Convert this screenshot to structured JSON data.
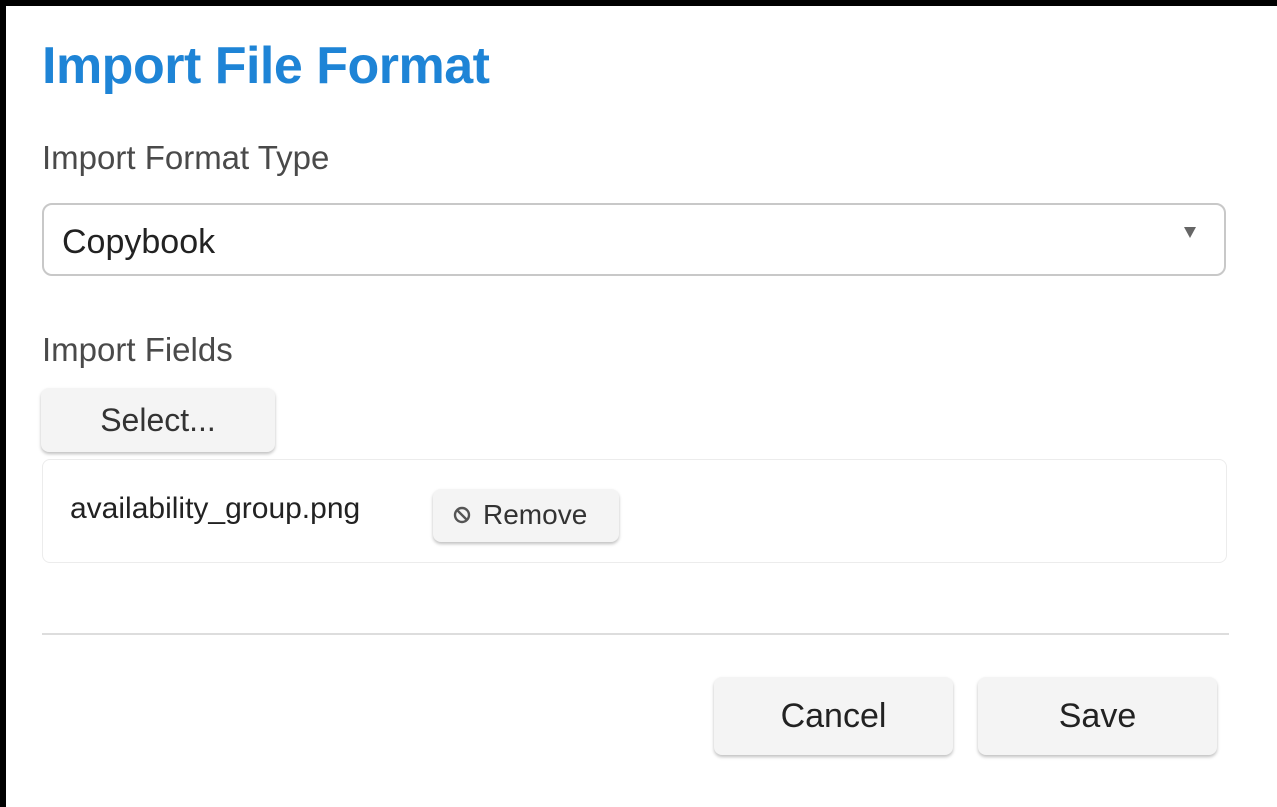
{
  "dialog": {
    "title": "Import File Format",
    "format_type": {
      "label": "Import Format Type",
      "selected_value": "Copybook",
      "arrow_icon": "caret-down-icon"
    },
    "import_fields": {
      "label": "Import Fields",
      "select_button_label": "Select...",
      "files": [
        {
          "name": "availability_group.png",
          "remove_label": "Remove",
          "remove_icon": "ban-icon"
        }
      ]
    },
    "actions": {
      "cancel_label": "Cancel",
      "save_label": "Save"
    }
  },
  "colors": {
    "title": "#1e84d6",
    "label": "#4a4a4a",
    "button_bg": "#f4f4f4",
    "border": "#c8c8c8"
  }
}
